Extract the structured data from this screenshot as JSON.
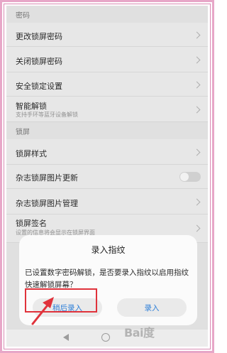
{
  "sections": {
    "password": "密码",
    "lock_screen": "锁屏"
  },
  "rows": {
    "change_password": "更改锁屏密码",
    "disable_password": "关闭锁屏密码",
    "security_lock": "安全锁定设置",
    "smart_unlock": "智能解锁",
    "smart_unlock_sub": "支持手环等蓝牙设备解锁",
    "lock_style": "锁屏样式",
    "magazine_update": "杂志锁屏图片更新",
    "magazine_manage": "杂志锁屏图片管理",
    "signature": "锁屏签名",
    "signature_sub": "设置的信息将会显示在锁屏界面"
  },
  "dialog": {
    "title": "录入指纹",
    "message": "已设置数字密码解锁，是否要录入指纹以启用指纹快速解锁屏幕？",
    "later_button": "稍后录入",
    "enroll_button": "录入"
  },
  "watermark": "Bai度",
  "colors": {
    "accent": "#2d7fd8",
    "highlight": "#e0323b",
    "frame": "#e7a7c8"
  },
  "toggle": {
    "magazine_update_on": false
  }
}
